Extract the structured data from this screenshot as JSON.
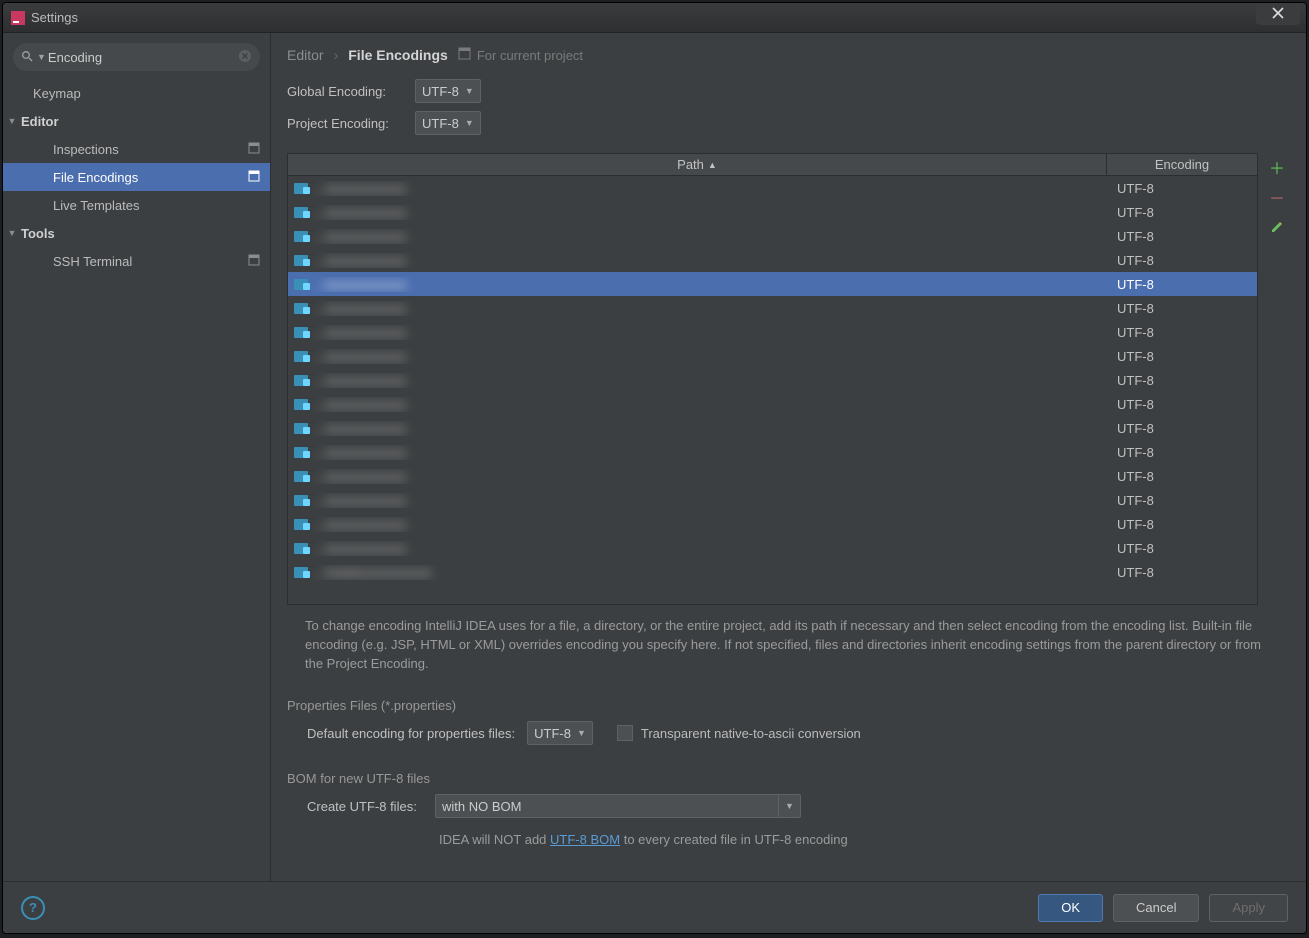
{
  "window": {
    "title": "Settings"
  },
  "search": {
    "value": "Encoding"
  },
  "sidebar": {
    "items": [
      {
        "label": "Keymap",
        "type": "leaf",
        "indent": 1,
        "scope": false
      },
      {
        "label": "Editor",
        "type": "cat",
        "indent": 0,
        "expanded": true
      },
      {
        "label": "Inspections",
        "type": "leaf",
        "indent": 2,
        "scope": true
      },
      {
        "label": "File Encodings",
        "type": "leaf",
        "indent": 2,
        "scope": true,
        "selected": true
      },
      {
        "label": "Live Templates",
        "type": "leaf",
        "indent": 2,
        "scope": false
      },
      {
        "label": "Tools",
        "type": "cat",
        "indent": 0,
        "expanded": true
      },
      {
        "label": "SSH Terminal",
        "type": "leaf",
        "indent": 2,
        "scope": true
      }
    ]
  },
  "breadcrumb": {
    "root": "Editor",
    "current": "File Encodings",
    "for_project": "For current project"
  },
  "options": {
    "global_label": "Global Encoding:",
    "global_value": "UTF-8",
    "project_label": "Project Encoding:",
    "project_value": "UTF-8"
  },
  "table": {
    "header_path": "Path",
    "header_encoding": "Encoding",
    "rows": [
      {
        "path": "...\\",
        "encoding": "UTF-8"
      },
      {
        "path": "...\\",
        "encoding": "UTF-8"
      },
      {
        "path": "...\\",
        "encoding": "UTF-8"
      },
      {
        "path": "...\\",
        "encoding": "UTF-8"
      },
      {
        "path": "...\\",
        "encoding": "UTF-8",
        "selected": true
      },
      {
        "path": "...\\",
        "encoding": "UTF-8"
      },
      {
        "path": "...\\",
        "encoding": "UTF-8"
      },
      {
        "path": "...\\",
        "encoding": "UTF-8"
      },
      {
        "path": "...\\",
        "encoding": "UTF-8"
      },
      {
        "path": "...\\",
        "encoding": "UTF-8"
      },
      {
        "path": "...\\",
        "encoding": "UTF-8"
      },
      {
        "path": "...\\",
        "encoding": "UTF-8"
      },
      {
        "path": "...\\",
        "encoding": "UTF-8"
      },
      {
        "path": "...\\",
        "encoding": "UTF-8"
      },
      {
        "path": "...\\",
        "encoding": "UTF-8"
      },
      {
        "path": "...\\",
        "encoding": "UTF-8"
      },
      {
        "path": "...\\med",
        "encoding": "UTF-8"
      }
    ]
  },
  "help": {
    "text": "To change encoding IntelliJ IDEA uses for a file, a directory, or the entire project, add its path if necessary and then select encoding from the encoding list. Built-in file encoding (e.g. JSP, HTML or XML) overrides encoding you specify here. If not specified, files and directories inherit encoding settings from the parent directory or from the Project Encoding."
  },
  "props": {
    "title": "Properties Files (*.properties)",
    "default_label": "Default encoding for properties files:",
    "default_value": "UTF-8",
    "chk_label": "Transparent native-to-ascii conversion"
  },
  "bom": {
    "title": "BOM for new UTF-8 files",
    "create_label": "Create UTF-8 files:",
    "create_value": "with NO BOM",
    "note_a": "IDEA will NOT add ",
    "note_link": "UTF-8 BOM",
    "note_b": " to every created file in UTF-8 encoding"
  },
  "footer": {
    "ok": "OK",
    "cancel": "Cancel",
    "apply": "Apply"
  }
}
